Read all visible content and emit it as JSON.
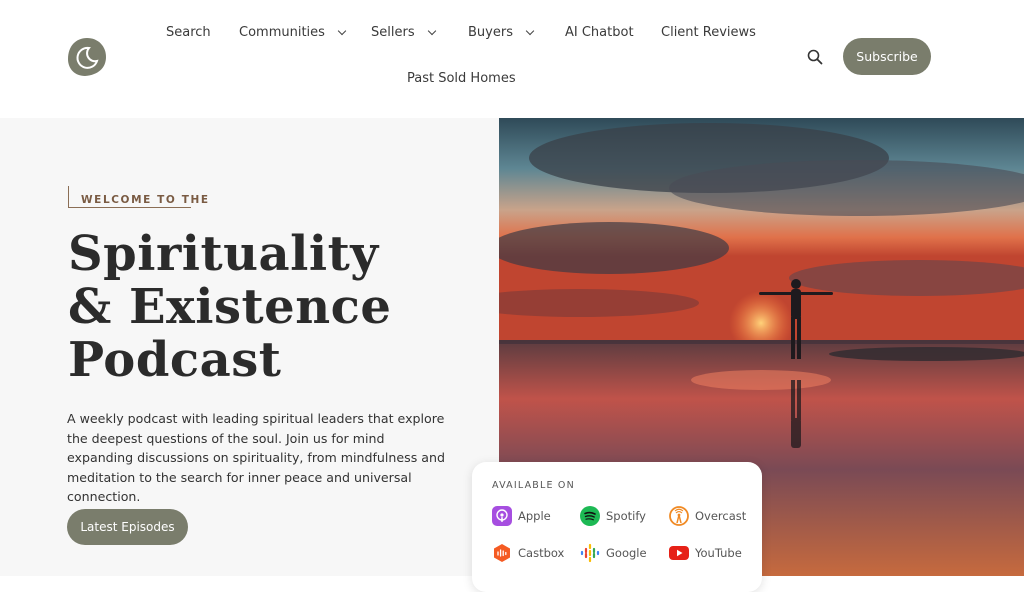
{
  "header": {
    "nav": [
      {
        "label": "Search",
        "has_dropdown": false
      },
      {
        "label": "Communities",
        "has_dropdown": true
      },
      {
        "label": "Sellers",
        "has_dropdown": true
      },
      {
        "label": "Buyers",
        "has_dropdown": true
      },
      {
        "label": "AI Chatbot",
        "has_dropdown": false
      },
      {
        "label": "Client Reviews",
        "has_dropdown": false
      },
      {
        "label": "Past Sold Homes",
        "has_dropdown": false
      }
    ],
    "search_icon": "search-icon",
    "subscribe_label": "Subscribe"
  },
  "hero": {
    "eyebrow": "WELCOME TO THE",
    "title_line1": "Spirituality",
    "title_line2": "& Existence",
    "title_line3": "Podcast",
    "description": "A weekly podcast with leading spiritual leaders that explore the deepest questions of the soul. Join us for mind expanding discussions on spirituality, from mindfulness and meditation to the search for inner peace and universal connection.",
    "cta_label": "Latest Episodes"
  },
  "available": {
    "label": "AVAILABLE ON",
    "platforms": [
      {
        "name": "Apple",
        "icon": "apple-podcasts-icon",
        "color": "#a64ee0"
      },
      {
        "name": "Spotify",
        "icon": "spotify-icon",
        "color": "#1db954"
      },
      {
        "name": "Overcast",
        "icon": "overcast-icon",
        "color": "#f08a24"
      },
      {
        "name": "Castbox",
        "icon": "castbox-icon",
        "color": "#f55b23"
      },
      {
        "name": "Google",
        "icon": "google-podcasts-icon",
        "color": "#4285f4"
      },
      {
        "name": "YouTube",
        "icon": "youtube-icon",
        "color": "#e62117"
      }
    ]
  },
  "colors": {
    "accent": "#7a7d6c",
    "eyebrow": "#7a5b43",
    "panel_bg": "#f7f7f7"
  }
}
